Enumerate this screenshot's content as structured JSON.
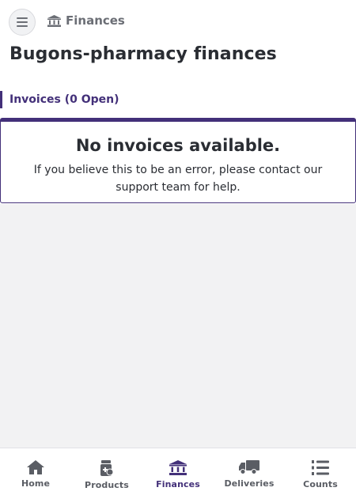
{
  "header": {
    "breadcrumb_label": "Finances",
    "breadcrumb_icon": "bank-icon",
    "menu_icon": "hamburger-icon"
  },
  "page": {
    "title": "Bugons-pharmacy finances"
  },
  "invoices": {
    "section_label": "Invoices (0 Open)",
    "empty_title": "No invoices available.",
    "empty_message": "If you believe this to be an error, please contact our support team for help."
  },
  "bottom_nav": {
    "items": [
      {
        "label": "Home",
        "icon": "home-icon",
        "active": false
      },
      {
        "label": "Products",
        "icon": "medication-icon",
        "active": false
      },
      {
        "label": "Finances",
        "icon": "bank-icon",
        "active": true
      },
      {
        "label": "Deliveries",
        "icon": "truck-icon",
        "active": false
      },
      {
        "label": "Counts",
        "icon": "list-icon",
        "active": false
      }
    ]
  },
  "colors": {
    "accent": "#433079",
    "text": "#2a2d33",
    "muted": "#6b6e75",
    "background": "#f2f2f3"
  }
}
